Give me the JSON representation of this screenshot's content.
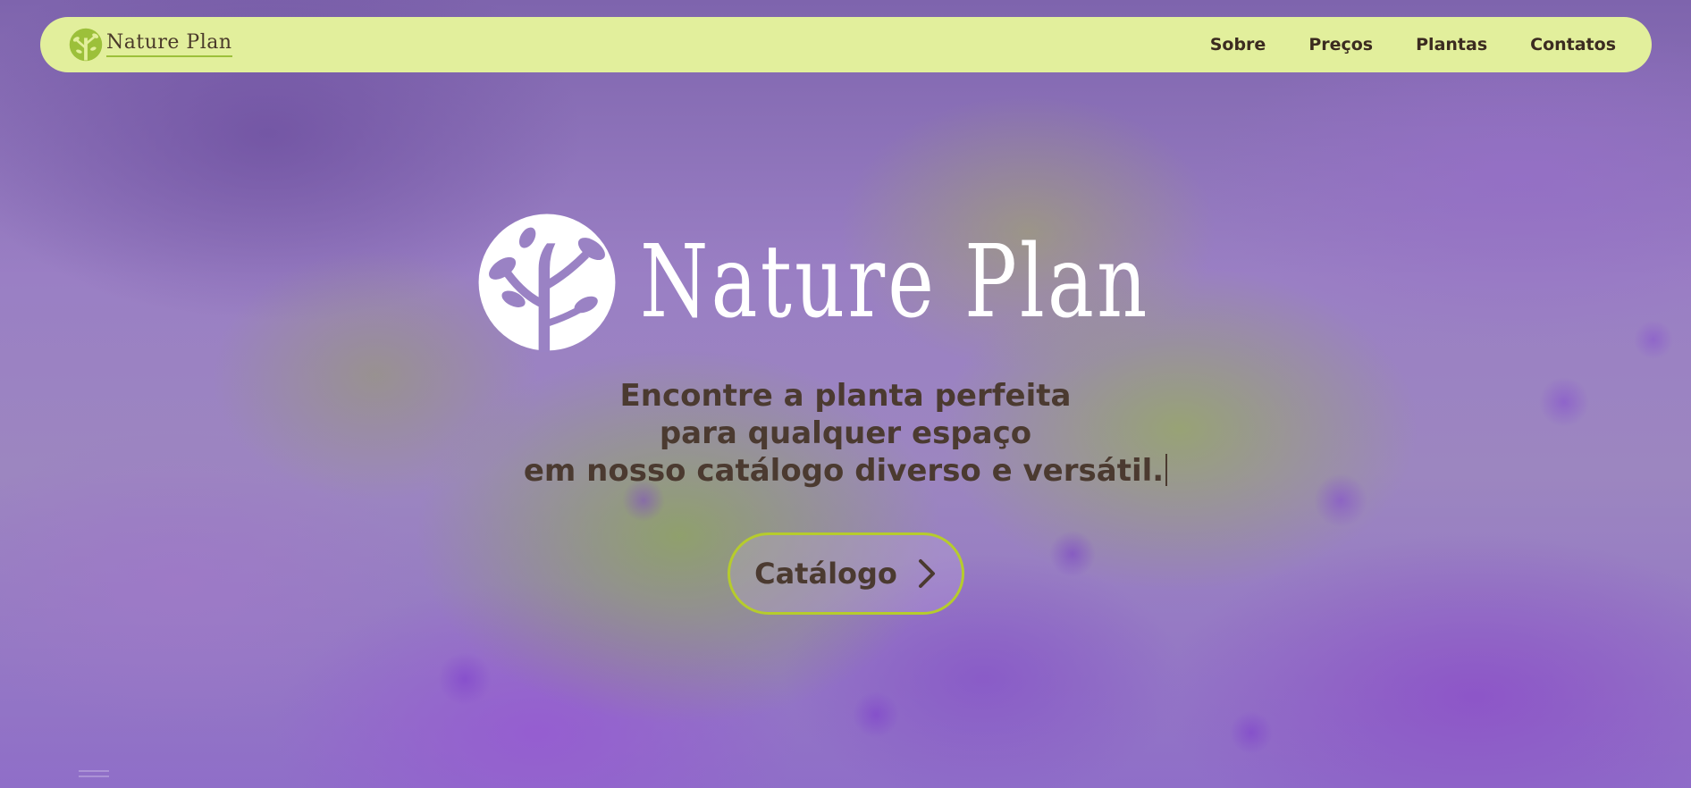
{
  "brand": {
    "name": "Nature Plan"
  },
  "nav": {
    "items": [
      {
        "label": "Sobre"
      },
      {
        "label": "Preços"
      },
      {
        "label": "Plantas"
      },
      {
        "label": "Contatos"
      }
    ]
  },
  "hero": {
    "title": "Nature Plan",
    "tagline": [
      "Encontre a planta perfeita",
      "para qualquer espaço",
      "em nosso catálogo diverso e versátil."
    ],
    "cta_label": "Catálogo"
  },
  "colors": {
    "nav_background": "#e2ef9c",
    "text_dark": "#4b3a30",
    "accent_green": "#b6cc2c",
    "logo_green": "#9cc03a"
  },
  "icons": {
    "brand_logo": "tree-circle-logo-icon",
    "cta_arrow": "chevron-right-icon"
  }
}
